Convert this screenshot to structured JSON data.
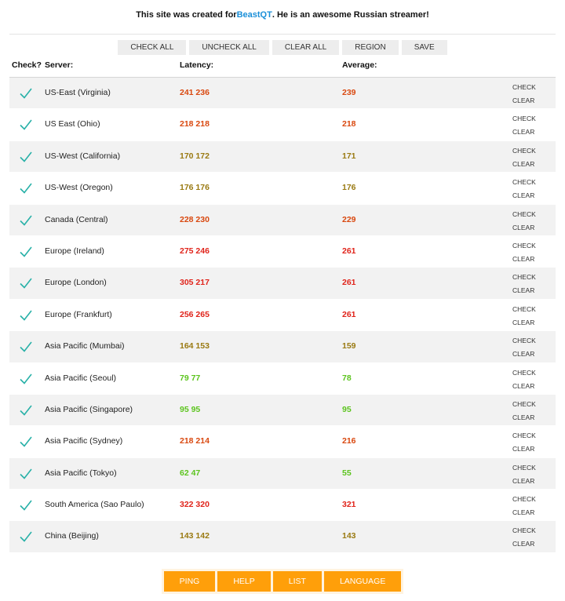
{
  "header": {
    "prefix": "This site was created for ",
    "link": "BeastQT",
    "suffix": ". He is an awesome Russian streamer!"
  },
  "toolbar": {
    "check_all": "CHECK ALL",
    "uncheck_all": "UNCHECK ALL",
    "clear_all": "CLEAR ALL",
    "region": "REGION",
    "save": "SAVE"
  },
  "columns": {
    "check": "Check?",
    "server": "Server:",
    "latency": "Latency:",
    "average": "Average:"
  },
  "row_actions": {
    "check": "CHECK",
    "clear": "CLEAR"
  },
  "colors": {
    "red": "#e0231a",
    "orange_red": "#d9480f",
    "olive": "#9a7a12",
    "green": "#5cc41e",
    "check": "#29b1a8",
    "accent": "#ff9f0a",
    "link": "#1a8fd8"
  },
  "servers": [
    {
      "name": "US-East (Virginia)",
      "latency": "241 236",
      "average": "239",
      "color": "orange_red"
    },
    {
      "name": "US East (Ohio)",
      "latency": "218 218",
      "average": "218",
      "color": "orange_red"
    },
    {
      "name": "US-West (California)",
      "latency": "170 172",
      "average": "171",
      "color": "olive"
    },
    {
      "name": "US-West (Oregon)",
      "latency": "176 176",
      "average": "176",
      "color": "olive"
    },
    {
      "name": "Canada (Central)",
      "latency": "228 230",
      "average": "229",
      "color": "orange_red"
    },
    {
      "name": "Europe (Ireland)",
      "latency": "275 246",
      "average": "261",
      "color": "red"
    },
    {
      "name": "Europe (London)",
      "latency": "305 217",
      "average": "261",
      "color": "red"
    },
    {
      "name": "Europe (Frankfurt)",
      "latency": "256 265",
      "average": "261",
      "color": "red"
    },
    {
      "name": "Asia Pacific (Mumbai)",
      "latency": "164 153",
      "average": "159",
      "color": "olive"
    },
    {
      "name": "Asia Pacific (Seoul)",
      "latency": "79 77",
      "average": "78",
      "color": "green"
    },
    {
      "name": "Asia Pacific (Singapore)",
      "latency": "95 95",
      "average": "95",
      "color": "green"
    },
    {
      "name": "Asia Pacific (Sydney)",
      "latency": "218 214",
      "average": "216",
      "color": "orange_red"
    },
    {
      "name": "Asia Pacific (Tokyo)",
      "latency": "62 47",
      "average": "55",
      "color": "green"
    },
    {
      "name": "South America (Sao Paulo)",
      "latency": "322 320",
      "average": "321",
      "color": "red"
    },
    {
      "name": "China (Beijing)",
      "latency": "143 142",
      "average": "143",
      "color": "olive"
    }
  ],
  "footer": {
    "ping": "PING",
    "help": "HELP",
    "list": "LIST",
    "language": "LANGUAGE"
  }
}
